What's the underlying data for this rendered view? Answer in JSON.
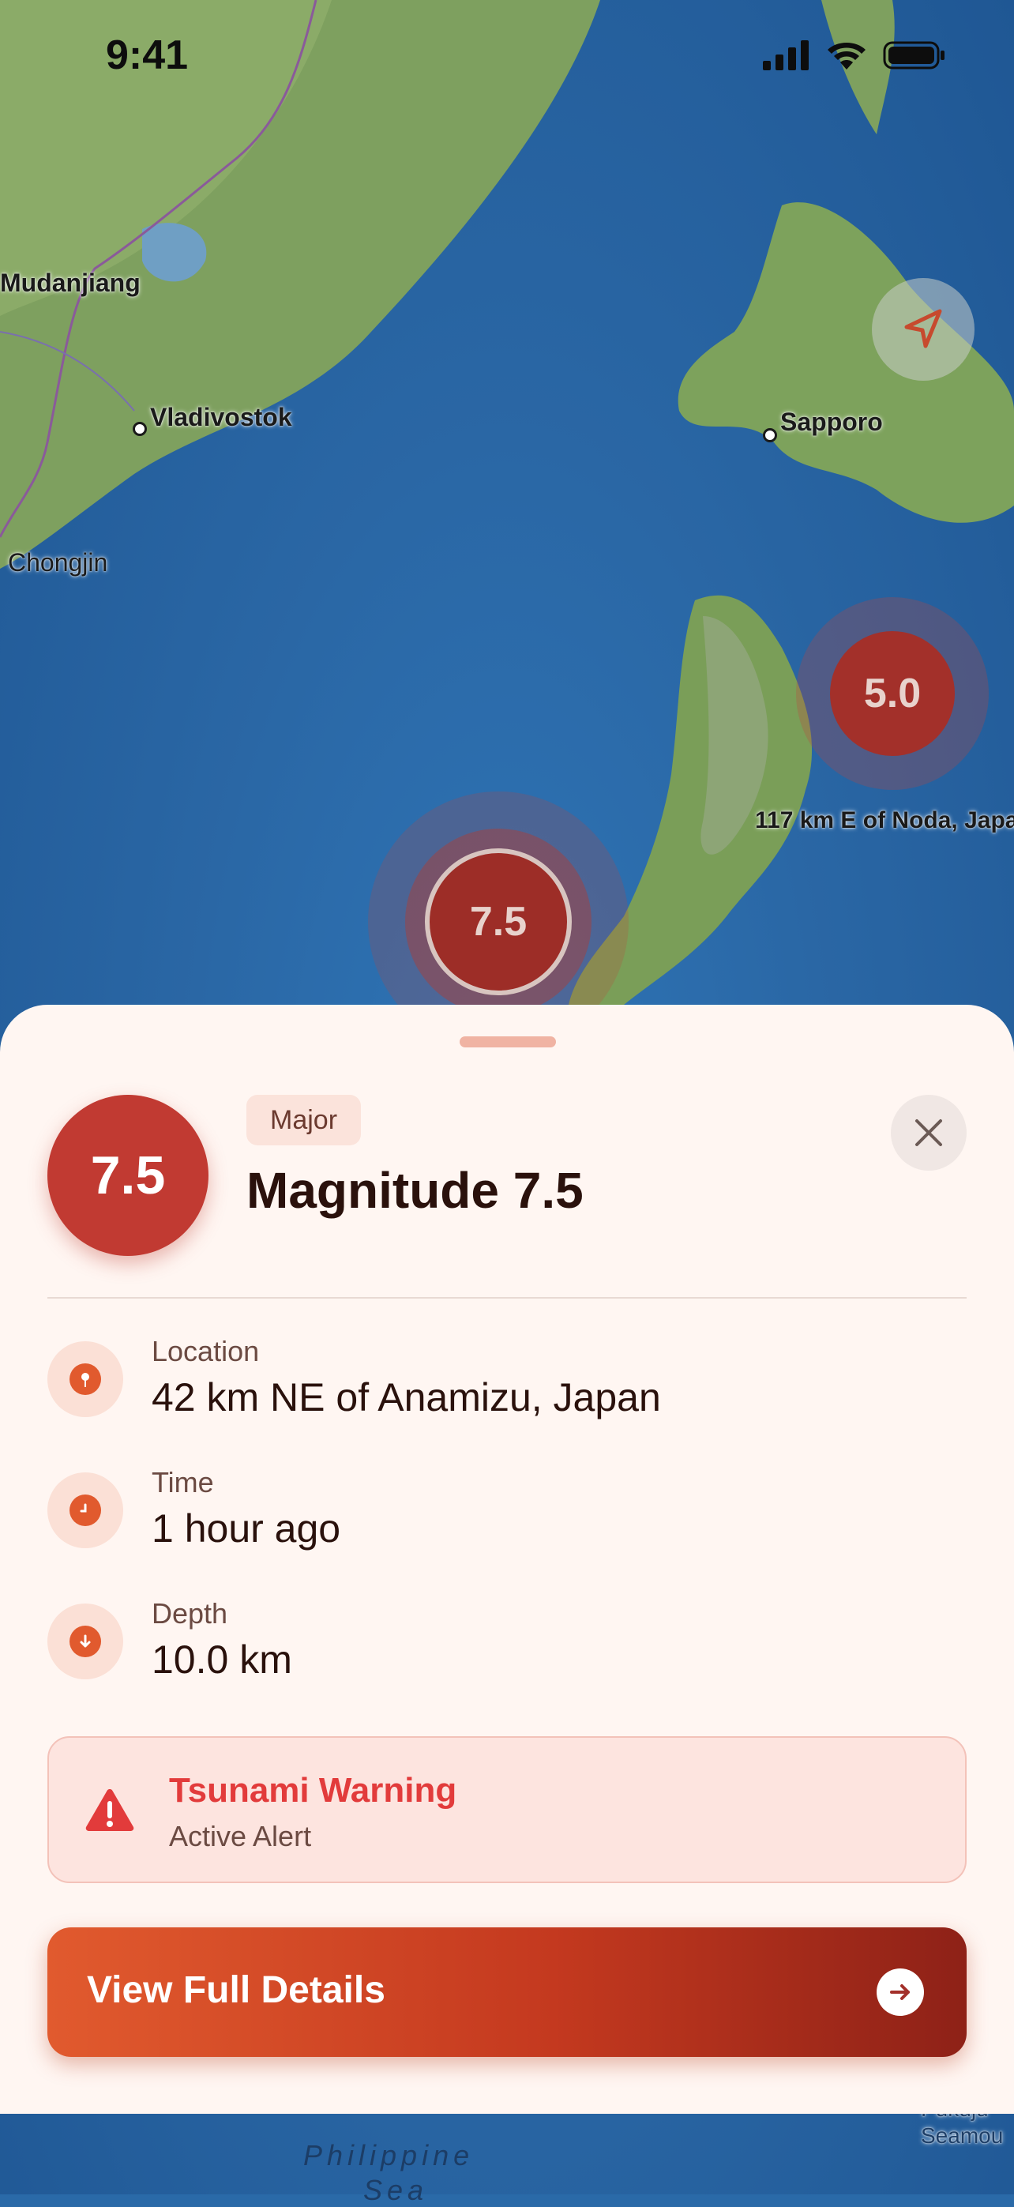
{
  "status_bar": {
    "time": "9:41"
  },
  "map": {
    "labels": {
      "mudanjiang": "Mudanjiang",
      "vladivostok": "Vladivostok",
      "chongjin": "Chongjin",
      "sapporo": "Sapporo",
      "noda": "117 km E of Noda, Japa",
      "philippine": "Philippine",
      "sea": "Sea",
      "pukuju": "Pukuju",
      "seamou": "Seamou"
    },
    "markers": [
      {
        "magnitude": "5.0"
      },
      {
        "magnitude": "7.5"
      }
    ]
  },
  "sheet": {
    "magnitude": "7.5",
    "badge": "Major",
    "title": "Magnitude 7.5",
    "details": [
      {
        "label": "Location",
        "value": "42 km NE of Anamizu, Japan",
        "icon": "pin-icon"
      },
      {
        "label": "Time",
        "value": "1 hour ago",
        "icon": "clock-icon"
      },
      {
        "label": "Depth",
        "value": "10.0 km",
        "icon": "arrow-down-icon"
      }
    ],
    "alert": {
      "title": "Tsunami Warning",
      "subtitle": "Active Alert",
      "icon": "warning-icon"
    },
    "cta": {
      "label": "View Full Details",
      "icon": "arrow-right-icon"
    }
  },
  "colors": {
    "accent": "#e15a2e",
    "magnitude": "#c13a32",
    "alert_red": "#e23b3b",
    "sheet_bg": "#fff6f2"
  }
}
